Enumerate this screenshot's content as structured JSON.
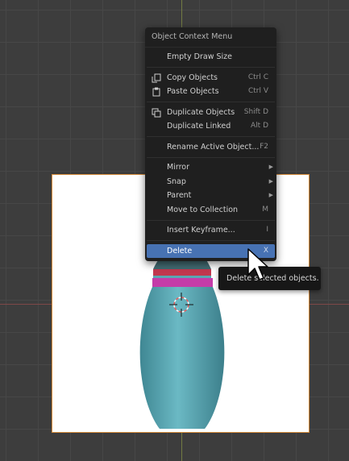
{
  "menu": {
    "title": "Object Context Menu",
    "items": [
      {
        "label": "Empty Draw Size",
        "shortcut": "",
        "submenu": false,
        "icon": ""
      },
      {
        "label": "Copy Objects",
        "shortcut": "Ctrl C",
        "submenu": false,
        "icon": "copy-icon"
      },
      {
        "label": "Paste Objects",
        "shortcut": "Ctrl V",
        "submenu": false,
        "icon": "paste-icon"
      },
      {
        "label": "Duplicate Objects",
        "shortcut": "Shift D",
        "submenu": false,
        "icon": "duplicate-icon"
      },
      {
        "label": "Duplicate Linked",
        "shortcut": "Alt D",
        "submenu": false,
        "icon": ""
      },
      {
        "label": "Rename Active Object...",
        "shortcut": "F2",
        "submenu": false,
        "icon": ""
      },
      {
        "label": "Mirror",
        "shortcut": "",
        "submenu": true,
        "icon": ""
      },
      {
        "label": "Snap",
        "shortcut": "",
        "submenu": true,
        "icon": ""
      },
      {
        "label": "Parent",
        "shortcut": "",
        "submenu": true,
        "icon": ""
      },
      {
        "label": "Move to Collection",
        "shortcut": "M",
        "submenu": false,
        "icon": ""
      },
      {
        "label": "Insert Keyframe...",
        "shortcut": "I",
        "submenu": false,
        "icon": ""
      },
      {
        "label": "Delete",
        "shortcut": "X",
        "submenu": false,
        "icon": "",
        "active": true
      }
    ]
  },
  "tooltip": {
    "text": "Delete selected objects."
  },
  "colors": {
    "accent": "#4772b3",
    "pin_body": "#5aa6b2",
    "pin_stripe_red": "#c2374e",
    "pin_stripe_pink": "#c43ca8",
    "grid_background": "#3d3d3d",
    "image_plane_border": "#d68b3a"
  }
}
